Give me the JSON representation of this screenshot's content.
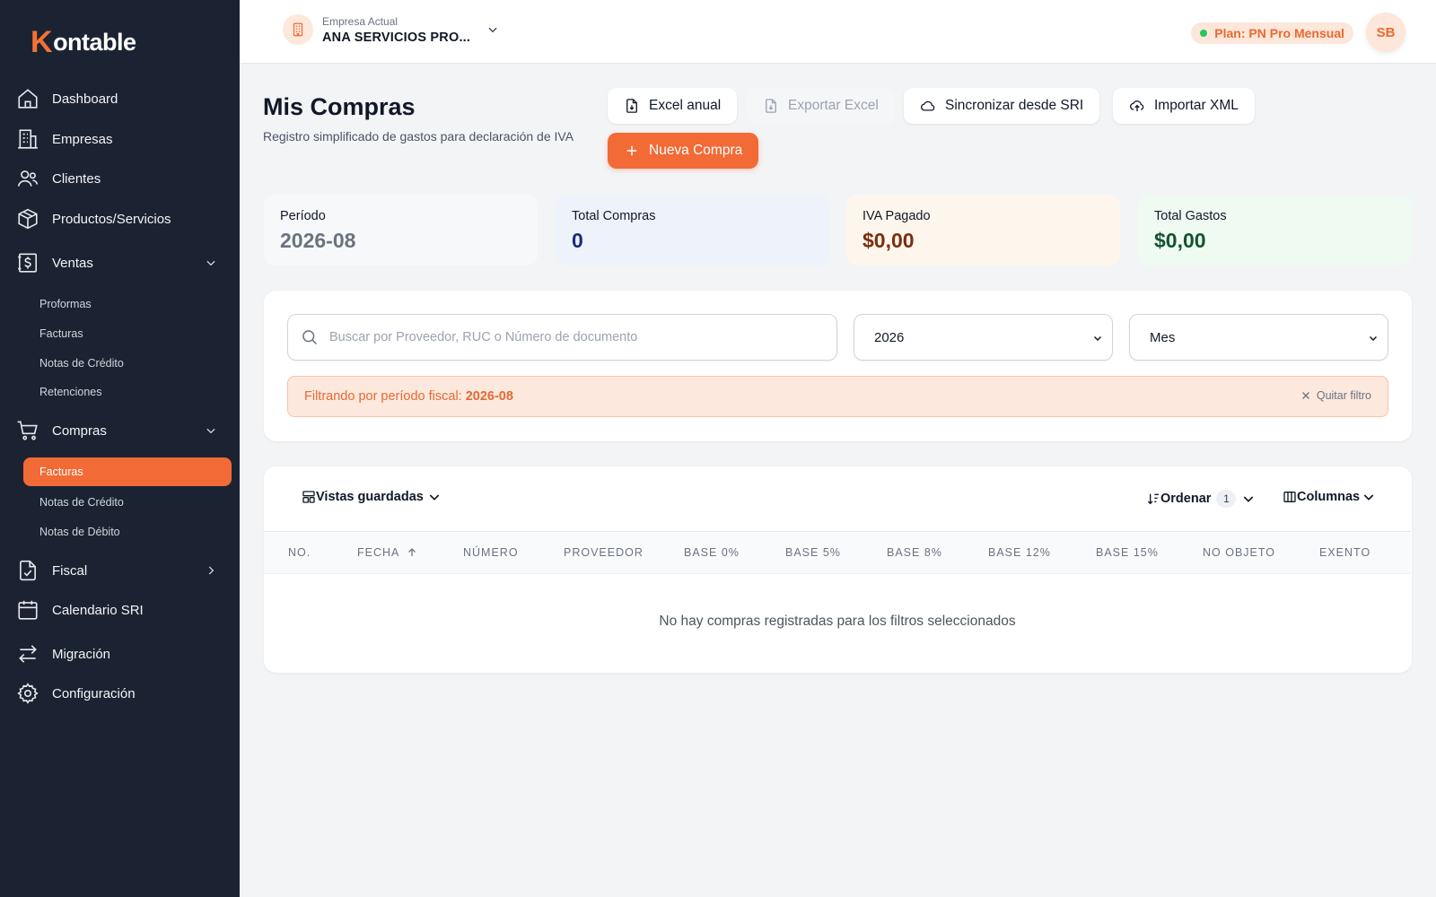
{
  "app": {
    "logo_mark": "K",
    "logo_text": "ontable"
  },
  "sidebar": {
    "items": [
      {
        "label": "Dashboard",
        "icon": "home-icon"
      },
      {
        "label": "Empresas",
        "icon": "building-icon"
      },
      {
        "label": "Clientes",
        "icon": "users-icon"
      },
      {
        "label": "Productos/Servicios",
        "icon": "box-icon"
      },
      {
        "label": "Ventas",
        "icon": "dollar-doc-icon",
        "expanded": true,
        "children": [
          "Proformas",
          "Facturas",
          "Notas de Crédito",
          "Retenciones"
        ]
      },
      {
        "label": "Compras",
        "icon": "cart-icon",
        "expanded": true,
        "children": [
          "Facturas",
          "Notas de Crédito",
          "Notas de Débito"
        ],
        "active_child": "Facturas"
      },
      {
        "label": "Fiscal",
        "icon": "doc-check-icon",
        "expanded": false
      },
      {
        "label": "Calendario SRI",
        "icon": "calendar-icon"
      },
      {
        "label": "Migración",
        "icon": "swap-icon"
      },
      {
        "label": "Configuración",
        "icon": "gear-icon"
      }
    ]
  },
  "topbar": {
    "company_caption": "Empresa Actual",
    "company_name": "ANA SERVICIOS PRO...",
    "plan": "Plan: PN Pro Mensual",
    "avatar": "SB"
  },
  "header": {
    "title": "Mis Compras",
    "subtitle": "Registro simplificado de gastos para declaración de IVA",
    "buttons": {
      "excel_anual": "Excel anual",
      "exportar_excel": "Exportar Excel",
      "sincronizar": "Sincronizar desde SRI",
      "importar_xml": "Importar XML",
      "nueva_compra": "Nueva Compra"
    }
  },
  "stats": [
    {
      "label": "Período",
      "value": "2026-08",
      "bg": "#f7f8fa",
      "color": "#6b7280"
    },
    {
      "label": "Total Compras",
      "value": "0",
      "bg": "#eef2fb",
      "color": "#1e2a78"
    },
    {
      "label": "IVA Pagado",
      "value": "$0,00",
      "bg": "#fdf6ec",
      "color": "#7a2e0e"
    },
    {
      "label": "Total Gastos",
      "value": "$0,00",
      "bg": "#eefaf2",
      "color": "#14532d"
    }
  ],
  "filters": {
    "search_placeholder": "Buscar por Proveedor, RUC o Número de documento",
    "year": "2026",
    "month": "Mes",
    "banner_prefix": "Filtrando por período fiscal:",
    "banner_value": "2026-08",
    "clear": "Quitar filtro"
  },
  "table": {
    "saved_views": "Vistas guardadas",
    "sort": "Ordenar",
    "sort_count": "1",
    "columns_btn": "Columnas",
    "columns": [
      "NO.",
      "FECHA",
      "NÚMERO",
      "PROVEEDOR",
      "BASE 0%",
      "BASE 5%",
      "BASE 8%",
      "BASE 12%",
      "BASE 15%",
      "NO OBJETO",
      "EXENTO"
    ],
    "empty_message": "No hay compras registradas para los filtros seleccionados"
  },
  "colors": {
    "accent": "#f26a35",
    "sidebar": "#1b2333"
  }
}
